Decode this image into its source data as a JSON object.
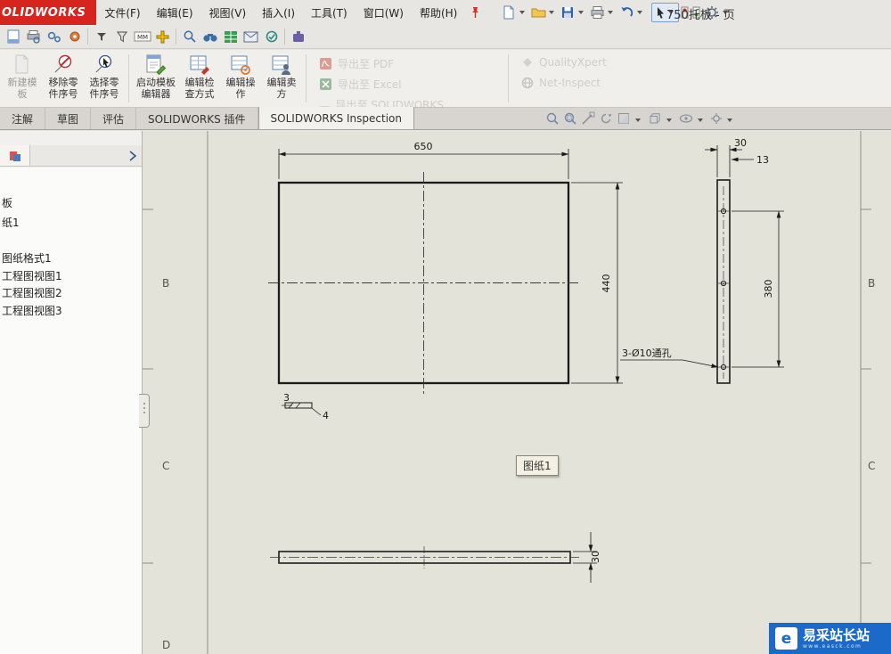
{
  "titlebar": {
    "logo": "OLIDWORKS",
    "menus": [
      "文件(F)",
      "编辑(E)",
      "视图(V)",
      "插入(I)",
      "工具(T)",
      "窗口(W)",
      "帮助(H)"
    ],
    "doc_title": "750托板 - 页"
  },
  "toolbar2": {
    "units": "MM"
  },
  "ribbon": {
    "buttons": [
      {
        "l1": "新建模",
        "l2": "板"
      },
      {
        "l1": "移除零",
        "l2": "件序号"
      },
      {
        "l1": "选择零",
        "l2": "件序号"
      },
      {
        "l1": "启动模板",
        "l2": "编辑器"
      },
      {
        "l1": "编辑检",
        "l2": "查方式"
      },
      {
        "l1": "编辑操",
        "l2": "作"
      },
      {
        "l1": "编辑卖",
        "l2": "方"
      }
    ],
    "exports": [
      "导出至 PDF",
      "导出至 Excel",
      "导出至 SOLIDWORKS Inspection 项目"
    ],
    "integrations": [
      "QualityXpert",
      "Net-Inspect"
    ]
  },
  "tabs": [
    "注解",
    "草图",
    "评估",
    "SOLIDWORKS 插件",
    "SOLIDWORKS Inspection"
  ],
  "panel": {
    "items": [
      "板",
      "纸1",
      "图纸格式1",
      "工程图视图1",
      "工程图视图2",
      "工程图视图3"
    ]
  },
  "drawing": {
    "dim_650": "650",
    "dim_440": "440",
    "dim_3": "3",
    "dim_4": "4",
    "dim_30_top": "30",
    "dim_13": "13",
    "dim_380": "380",
    "dim_30_bottom": "30",
    "hole_note": "3-Ø10通孔",
    "tooltip": "图纸1",
    "zones": {
      "left": [
        "B",
        "C",
        "D"
      ],
      "right": [
        "B",
        "C"
      ]
    }
  },
  "watermark": {
    "title": "易采站长站",
    "subtitle": "www.easck.com"
  }
}
